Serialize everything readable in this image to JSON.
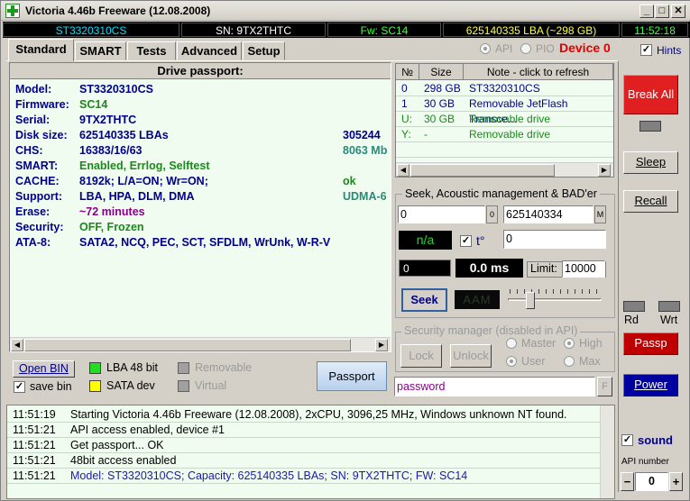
{
  "window": {
    "title": "Victoria 4.46b Freeware (12.08.2008)",
    "min_glyph": "_",
    "max_glyph": "□",
    "close_glyph": "✕"
  },
  "status_strip": {
    "model": "ST3320310CS",
    "serial": "SN: 9TX2THTC",
    "firmware": "Fw: SC14",
    "lba": "625140335 LBA (~298 GB)",
    "time": "11:52:18",
    "colors": {
      "model": "#00e0ff",
      "serial": "#ffffff",
      "firmware": "#40ff40",
      "lba": "#ffff40",
      "time": "#40ff40"
    }
  },
  "tabs": [
    "Standard",
    "SMART",
    "Tests",
    "Advanced",
    "Setup"
  ],
  "mode": {
    "api_label": "API",
    "pio_label": "PIO",
    "device_label": "Device 0",
    "hints_label": "Hints",
    "hints_checked": true
  },
  "passport": {
    "header": "Drive passport:",
    "rows": [
      {
        "label": "Model:",
        "value": "ST3320310CS",
        "value_color": "#00008b",
        "right": "",
        "right_color": ""
      },
      {
        "label": "Firmware:",
        "value": "SC14",
        "value_color": "#1a8a1a",
        "right": "",
        "right_color": ""
      },
      {
        "label": "Serial:",
        "value": "9TX2THTC",
        "value_color": "#00008b",
        "right": "",
        "right_color": ""
      },
      {
        "label": "Disk size:",
        "value": "625140335 LBAs",
        "value_color": "#00008b",
        "right": "305244",
        "right_color": "#00008b"
      },
      {
        "label": "CHS:",
        "value": "16383/16/63",
        "value_color": "#00008b",
        "right": "8063 Mb",
        "right_color": "#2a8a7a"
      },
      {
        "label": "SMART:",
        "value": "Enabled, Errlog, Selftest",
        "value_color": "#1a8a1a",
        "right": "",
        "right_color": ""
      },
      {
        "label": "CACHE:",
        "value": "8192k; L/A=ON; Wr=ON;",
        "value_color": "#00008b",
        "right": "ok",
        "right_color": "#1a8a1a"
      },
      {
        "label": "Support:",
        "value": "LBA, HPA, DLM, DMA",
        "value_color": "#00008b",
        "right": "UDMA-6",
        "right_color": "#2a8a7a"
      },
      {
        "label": "Erase:",
        "value": "~72 minutes",
        "value_color": "#8b008b",
        "right": "",
        "right_color": ""
      },
      {
        "label": "Security:",
        "value": "OFF, Frozen",
        "value_color": "#1a8a1a",
        "right": "",
        "right_color": ""
      },
      {
        "label": "ATA-8:",
        "value": "SATA2, NCQ, PEC, SCT, SFDLM, WrUnk, W-R-V",
        "value_color": "#00008b",
        "right": "",
        "right_color": ""
      }
    ]
  },
  "bottom_controls": {
    "open_bin": "Open BIN",
    "save_bin": "save bin",
    "save_bin_checked": true,
    "lba48": "LBA 48 bit",
    "sata_dev": "SATA dev",
    "removable": "Removable",
    "virtual": "Virtual",
    "passport_btn": "Passport",
    "colors": {
      "lba48": "#22dd22",
      "sata": "#ffff00",
      "inactive": "#a0a0a0"
    }
  },
  "drives": {
    "headers": [
      "№",
      "Size",
      "Note - click to refresh"
    ],
    "rows": [
      {
        "num": "0",
        "size": "298 GB",
        "note": "ST3320310CS",
        "color": "#00008b"
      },
      {
        "num": "1",
        "size": "30 GB",
        "note": "Removable JetFlash Transce...",
        "color": "#00008b"
      },
      {
        "num": "U:",
        "size": "30 GB",
        "note": "Removable drive",
        "color": "#1a8a1a"
      },
      {
        "num": "Y:",
        "size": "-",
        "note": "Removable drive",
        "color": "#1a8a1a"
      }
    ]
  },
  "seek": {
    "title": "Seek, Acoustic management & BAD'er",
    "from": "0",
    "to": "625140334",
    "zero_btn": "0",
    "max_btn": "M",
    "status": "n/a",
    "temp_label": "t°",
    "temp_checked": true,
    "temp_value": "0",
    "lba_value": "0",
    "time_value": "0.0 ms",
    "limit_label": "Limit:",
    "limit_value": "10000",
    "seek_btn": "Seek",
    "aam_label": "AAM"
  },
  "security": {
    "title": "Security manager (disabled in API)",
    "lock": "Lock",
    "unlock": "Unlock",
    "master": "Master",
    "high": "High",
    "user": "User",
    "max": "Max",
    "password_value": "password",
    "f_btn": "F"
  },
  "right_panel": {
    "break_all": "Break All",
    "sleep": "Sleep",
    "recall": "Recall",
    "rd": "Rd",
    "wrt": "Wrt",
    "passp": "Passp",
    "power": "Power",
    "sound": "sound",
    "sound_checked": true,
    "api_number_label": "API number",
    "api_minus": "−",
    "api_value": "0",
    "api_plus": "+"
  },
  "log": [
    {
      "time": "11:51:19",
      "message": "Starting Victoria 4.46b Freeware (12.08.2008), 2xCPU, 3096,25 MHz, Windows unknown NT found.",
      "color": "#000000"
    },
    {
      "time": "11:51:21",
      "message": "API access enabled, device #1",
      "color": "#000000"
    },
    {
      "time": "11:51:21",
      "message": "Get passport... OK",
      "color": "#000000"
    },
    {
      "time": "11:51:21",
      "message": "48bit access enabled",
      "color": "#000000"
    },
    {
      "time": "11:51:21",
      "message": "Model: ST3320310CS; Capacity: 625140335 LBAs; SN: 9TX2THTC; FW: SC14",
      "color": "#1a1aaa"
    }
  ]
}
